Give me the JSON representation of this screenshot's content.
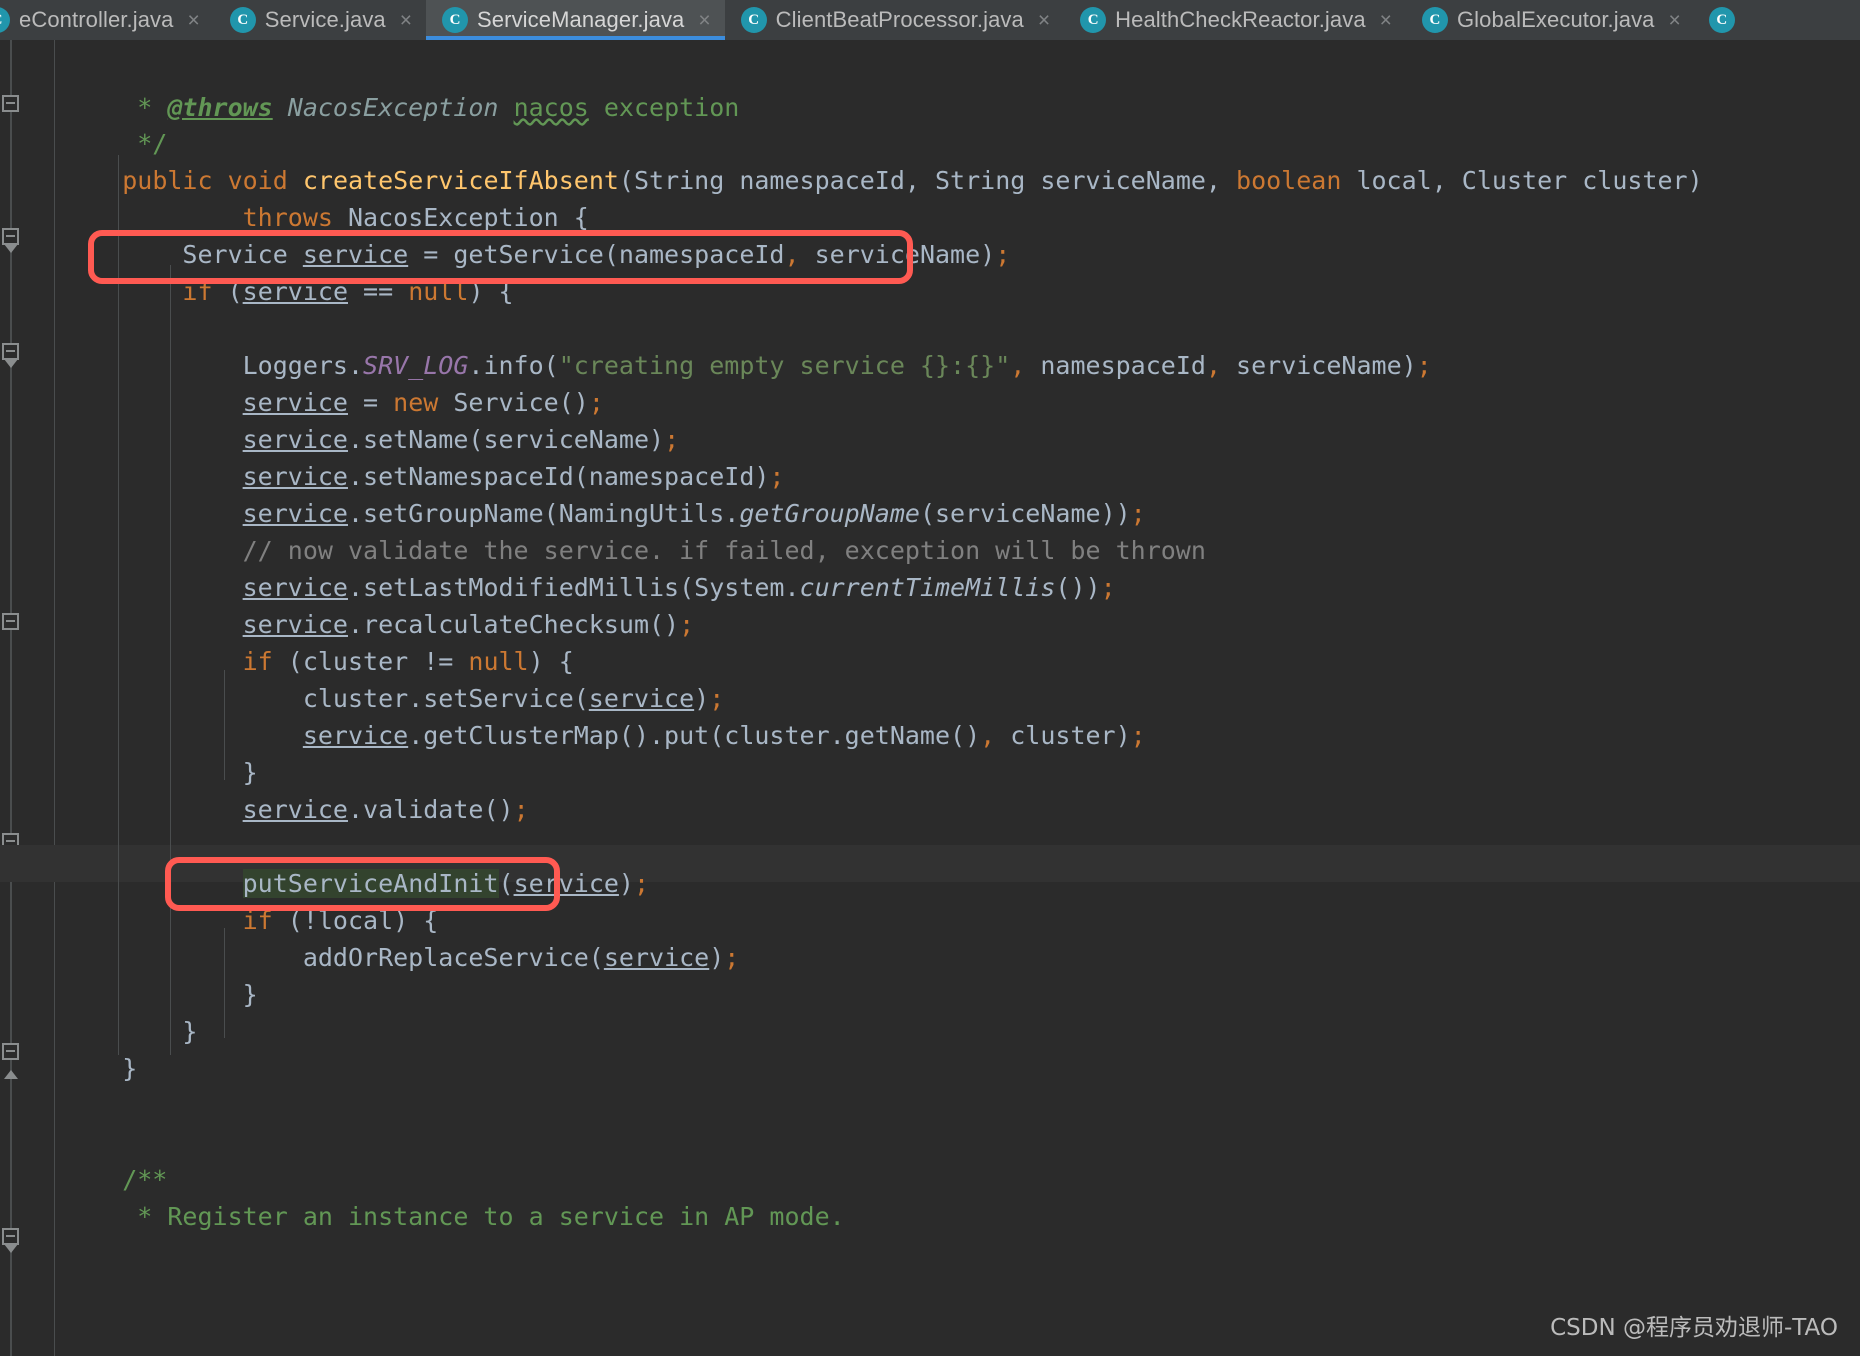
{
  "tabs": [
    {
      "label": "eController.java",
      "icon": "java-class-icon",
      "active": false,
      "clipped": true,
      "close": "×"
    },
    {
      "label": "Service.java",
      "icon": "java-class-icon",
      "active": false,
      "clipped": false,
      "close": "×"
    },
    {
      "label": "ServiceManager.java",
      "icon": "java-class-icon",
      "active": true,
      "clipped": false,
      "close": "×"
    },
    {
      "label": "ClientBeatProcessor.java",
      "icon": "java-class-icon",
      "active": false,
      "clipped": false,
      "close": "×"
    },
    {
      "label": "HealthCheckReactor.java",
      "icon": "java-class-icon",
      "active": false,
      "clipped": false,
      "close": "×"
    },
    {
      "label": "GlobalExecutor.java",
      "icon": "java-class-icon",
      "active": false,
      "clipped": false,
      "close": "×"
    }
  ],
  "tab_icon_letter": "C",
  "colors": {
    "editor_bg": "#2b2b2b",
    "tabbar_bg": "#3c3f41",
    "active_tab_bg": "#4e5254",
    "active_tab_underline": "#3c8ddd",
    "icon_blue": "#2196ac",
    "keyword_orange": "#cc7832",
    "method_yellow": "#ffc66d",
    "string_green": "#6a8759",
    "javadoc_green": "#629755",
    "comment_grey": "#808080",
    "static_purple": "#9876aa",
    "default_text": "#a9b7c6",
    "annotation_red": "#ff5a52",
    "occurrence_highlight_green": "#33432e",
    "current_line_bg": "#323232"
  },
  "code": {
    "file": "ServiceManager.java",
    "lines": [
      "     * @throws NacosException nacos exception",
      "     */",
      "    public void createServiceIfAbsent(String namespaceId, String serviceName, boolean local, Cluster cluster)",
      "            throws NacosException {",
      "        Service service = getService(namespaceId, serviceName);",
      "        if (service == null) {",
      "",
      "            Loggers.SRV_LOG.info(\"creating empty service {}:{}\", namespaceId, serviceName);",
      "            service = new Service();",
      "            service.setName(serviceName);",
      "            service.setNamespaceId(namespaceId);",
      "            service.setGroupName(NamingUtils.getGroupName(serviceName));",
      "            // now validate the service. if failed, exception will be thrown",
      "            service.setLastModifiedMillis(System.currentTimeMillis());",
      "            service.recalculateChecksum();",
      "            if (cluster != null) {",
      "                cluster.setService(service);",
      "                service.getClusterMap().put(cluster.getName(), cluster);",
      "            }",
      "            service.validate();",
      "",
      "            putServiceAndInit(service);",
      "            if (!local) {",
      "                addOrReplaceService(service);",
      "            }",
      "        }",
      "    }",
      "",
      "",
      "    /**",
      "     * Register an instance to a service in AP mode."
    ]
  },
  "annotations": {
    "box_1_target": "Service service = getService(namespaceId, serviceName);",
    "box_2_target": "putServiceAndInit(service);",
    "highlighted_identifier": "putServiceAndInit"
  },
  "watermark": "CSDN @程序员劝退师-TAO"
}
